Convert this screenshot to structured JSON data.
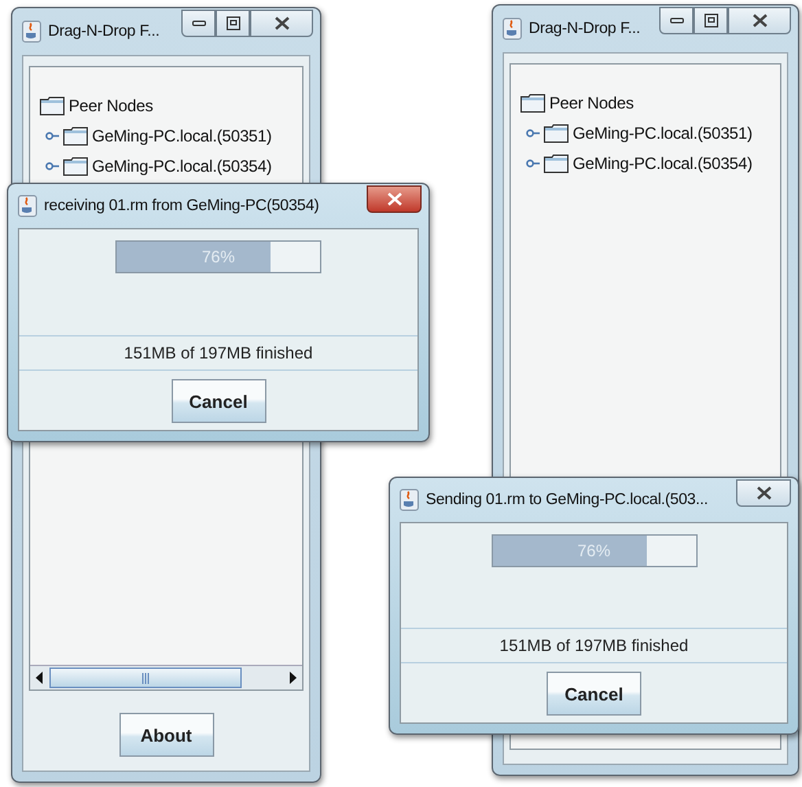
{
  "windows": [
    {
      "title": "Drag-N-Drop F...",
      "tree": {
        "label": "Peer Nodes",
        "children": [
          {
            "label": "GeMing-PC.local.(50351)"
          },
          {
            "label": "GeMing-PC.local.(50354)"
          }
        ]
      },
      "scrollbar": true,
      "button": "About"
    },
    {
      "title": "Drag-N-Drop F...",
      "tree": {
        "label": "Peer Nodes",
        "children": [
          {
            "label": "GeMing-PC.local.(50351)"
          },
          {
            "label": "GeMing-PC.local.(50354)"
          }
        ]
      },
      "scrollbar": false
    }
  ],
  "dialogs": [
    {
      "title": "receiving 01.rm from GeMing-PC(50354)",
      "active": true,
      "level": 0.76,
      "percent": "76%",
      "status": "151MB of 197MB finished",
      "button": "Cancel"
    },
    {
      "title": "Sending 01.rm to GeMing-PC.local.(503...",
      "active": false,
      "level": 0.76,
      "percent": "76%",
      "status": "151MB of 197MB finished",
      "button": "Cancel"
    }
  ]
}
